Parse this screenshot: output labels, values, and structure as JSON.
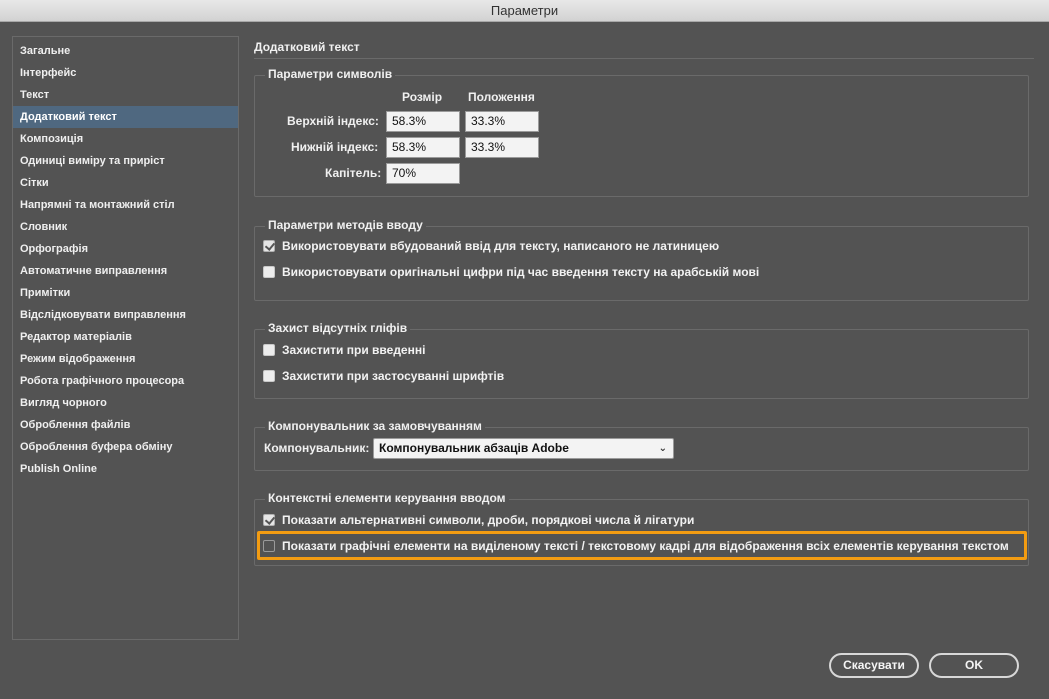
{
  "window": {
    "title": "Параметри"
  },
  "sidebar": {
    "items": [
      {
        "label": "Загальне"
      },
      {
        "label": "Інтерфейс"
      },
      {
        "label": "Текст"
      },
      {
        "label": "Додатковий текст",
        "selected": true
      },
      {
        "label": "Композиція"
      },
      {
        "label": "Одиниці виміру та приріст"
      },
      {
        "label": "Сітки"
      },
      {
        "label": "Напрямні та монтажний стіл"
      },
      {
        "label": "Словник"
      },
      {
        "label": "Орфографія"
      },
      {
        "label": "Автоматичне виправлення"
      },
      {
        "label": "Примітки"
      },
      {
        "label": "Відслідковувати виправлення"
      },
      {
        "label": "Редактор матеріалів"
      },
      {
        "label": "Режим відображення"
      },
      {
        "label": "Робота графічного процесора"
      },
      {
        "label": "Вигляд чорного"
      },
      {
        "label": "Оброблення файлів"
      },
      {
        "label": "Оброблення буфера обміну"
      },
      {
        "label": "Publish Online"
      }
    ]
  },
  "main": {
    "title": "Додатковий текст",
    "char_settings": {
      "title": "Параметри символів",
      "col_size": "Розмір",
      "col_position": "Положення",
      "superscript": {
        "label": "Верхній індекс:",
        "size": "58.3%",
        "position": "33.3%"
      },
      "subscript": {
        "label": "Нижній індекс:",
        "size": "58.3%",
        "position": "33.3%"
      },
      "smallcaps": {
        "label": "Капітель:",
        "size": "70%"
      }
    },
    "input_method": {
      "title": "Параметри методів вводу",
      "opt1": {
        "label": "Використовувати вбудований ввід для тексту, написаного не латиницею",
        "checked": true
      },
      "opt2": {
        "label": "Використовувати оригінальні цифри під час введення тексту на арабській мові",
        "checked": false
      }
    },
    "missing_glyph": {
      "title": "Захист відсутніх гліфів",
      "opt1": {
        "label": "Захистити при введенні",
        "checked": false
      },
      "opt2": {
        "label": "Захистити при застосуванні шрифтів",
        "checked": false
      }
    },
    "composer": {
      "title": "Компонувальник за замовчуванням",
      "label": "Компонувальник:",
      "value": "Компонувальник абзаців Adobe"
    },
    "contextual": {
      "title": "Контекстні елементи керування вводом",
      "opt1": {
        "label": "Показати альтернативні символи, дроби, порядкові числа й лігатури",
        "checked": true
      },
      "opt2": {
        "label": "Показати графічні елементи на виділеному тексті / текстовому кадрі для відображення всіх елементів керування текстом",
        "checked": false
      }
    }
  },
  "buttons": {
    "cancel": "Скасувати",
    "ok": "OK"
  },
  "colors": {
    "highlight": "#f39c12",
    "selection": "#4f6880",
    "background": "#535353"
  }
}
